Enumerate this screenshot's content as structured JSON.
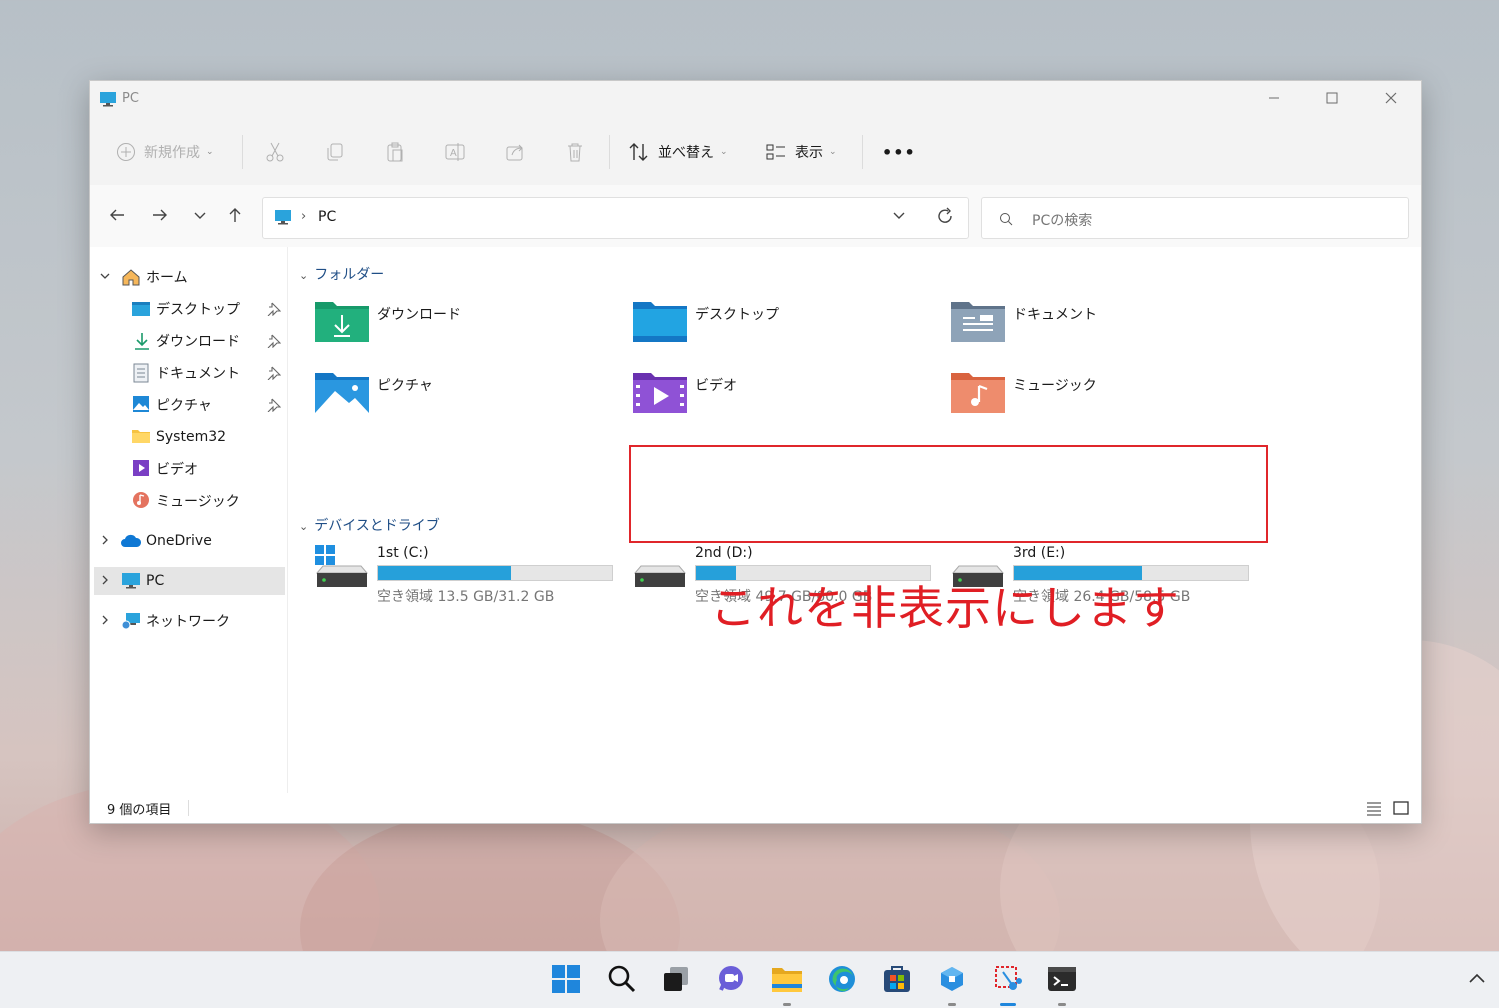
{
  "window": {
    "title": "PC"
  },
  "toolbar": {
    "new_label": "新規作成",
    "sort_label": "並べ替え",
    "view_label": "表示",
    "more_label": "•••"
  },
  "navbar": {
    "path": "PC",
    "search_placeholder": "PCの検索"
  },
  "sidebar": {
    "home": "ホーム",
    "quick": [
      "デスクトップ",
      "ダウンロード",
      "ドキュメント",
      "ピクチャ",
      "System32",
      "ビデオ",
      "ミュージック"
    ],
    "onedrive": "OneDrive",
    "pc": "PC",
    "network": "ネットワーク"
  },
  "content": {
    "folders_header": "フォルダー",
    "folders": [
      "ダウンロード",
      "デスクトップ",
      "ドキュメント",
      "ピクチャ",
      "ビデオ",
      "ミュージック"
    ],
    "drives_header": "デバイスとドライブ",
    "drives": [
      {
        "name": "1st (C:)",
        "free": "空き領域 13.5 GB/31.2 GB",
        "used_fraction": 0.567
      },
      {
        "name": "2nd (D:)",
        "free": "空き領域 49.7 GB/60.0 GB",
        "used_fraction": 0.172
      },
      {
        "name": "3rd (E:)",
        "free": "空き領域 26.4 GB/58.5 GB",
        "used_fraction": 0.549
      }
    ]
  },
  "status": {
    "count": "9 個の項目"
  },
  "annotation": {
    "text": "これを非表示にします",
    "color": "#e01e24"
  },
  "colors": {
    "accent": "#26a0da"
  },
  "taskbar": {
    "icons": [
      "start-icon",
      "search-icon",
      "task-view-icon",
      "chat-icon",
      "file-explorer-icon",
      "edge-icon",
      "store-icon",
      "app-icon",
      "snipping-tool-icon",
      "terminal-icon"
    ]
  }
}
